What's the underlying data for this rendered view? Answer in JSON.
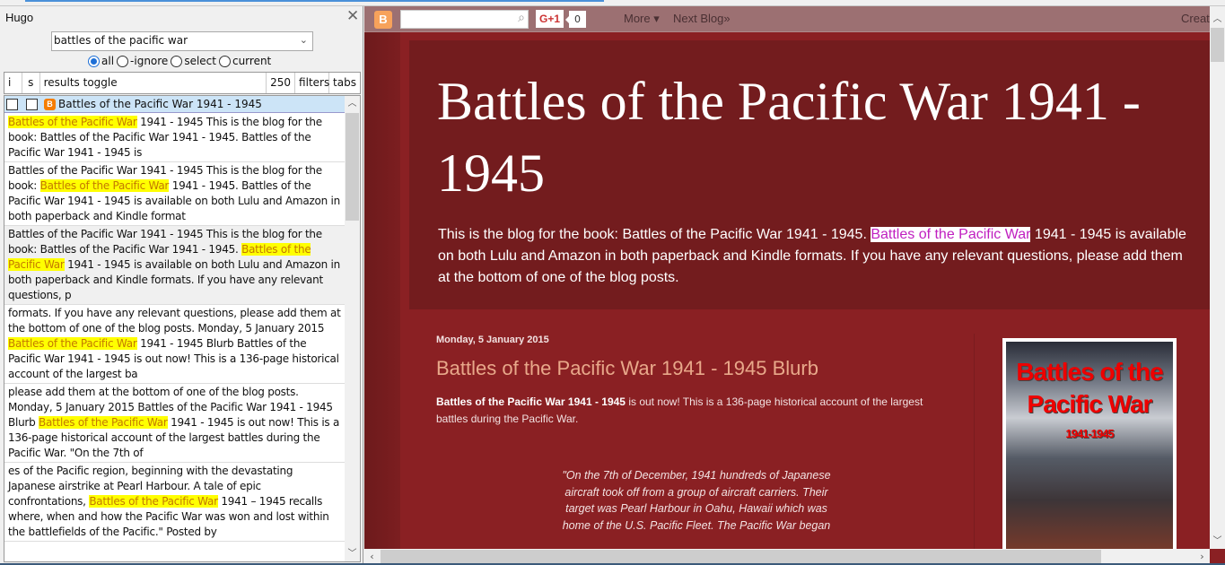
{
  "hugo": {
    "title": "Hugo",
    "close_glyph": "✕",
    "search_value": "battles of the pacific war",
    "radio_options": [
      {
        "label": "all",
        "selected": true
      },
      {
        "label": "-ignore",
        "selected": false
      },
      {
        "label": "select",
        "selected": false
      },
      {
        "label": "current",
        "selected": false
      }
    ],
    "columns": {
      "i": "i",
      "s": "s",
      "toggle": "results toggle",
      "count": "250",
      "filters": "filters",
      "tabs": "tabs"
    },
    "result_title": "Battles of the Pacific War 1941 - 1945",
    "highlight": "Battles of the Pacific War",
    "snippets": [
      {
        "before": "",
        "mark": "Battles of the Pacific War",
        "after": " 1941 - 1945 This is the blog for the book: Battles of the Pacific War 1941 - 1945. Battles of the Pacific War 1941 - 1945 is",
        "selected": false
      },
      {
        "before": "Battles of the Pacific War 1941 - 1945 This is the blog for the book: ",
        "mark": "Battles of the Pacific War",
        "after": " 1941 - 1945. Battles of the Pacific War 1941 - 1945 is available on both Lulu and Amazon in both paperback and Kindle format",
        "selected": false
      },
      {
        "before": "Battles of the Pacific War 1941 - 1945 This is the blog for the book: Battles of the Pacific War 1941 - 1945. ",
        "mark": "Battles of the Pacific War",
        "after": " 1941 - 1945 is available on both Lulu and Amazon in both paperback and Kindle formats. If you have any relevant questions, p",
        "selected": true
      },
      {
        "before": "formats. If you have any relevant questions, please add them at the bottom of one of the blog posts. Monday, 5 January 2015 ",
        "mark": "Battles of the Pacific War",
        "after": " 1941 - 1945 Blurb Battles of the Pacific War 1941 - 1945 is out now! This is a 136-page historical account of the largest ba",
        "selected": false
      },
      {
        "before": "please add them at the bottom of one of the blog posts. Monday, 5 January 2015 Battles of the Pacific War 1941 - 1945 Blurb ",
        "mark": "Battles of the Pacific War",
        "after": " 1941 - 1945 is out now! This is a 136-page historical account of the largest battles during the Pacific War. \"On the 7th of",
        "selected": false
      },
      {
        "before": "es of the Pacific region, beginning with the devastating Japanese airstrike at Pearl Harbour. A tale of epic confrontations, ",
        "mark": "Battles of the Pacific War",
        "after": " 1941 – 1945 recalls where, when and how the Pacific War was won and lost within the battlefields of the Pacific.\" Posted by",
        "selected": false
      }
    ]
  },
  "navbar": {
    "logo_glyph": "B",
    "search_icon_glyph": "⌕",
    "gplus_label": "G+1",
    "gplus_count": "0",
    "more_label": "More ▾",
    "next_blog_label": "Next Blog»",
    "create_label": "Create"
  },
  "blog": {
    "title": "Battles of the Pacific War 1941 - 1945",
    "desc_before": "This is the blog for the book: Battles of the Pacific War 1941 - 1945. ",
    "desc_mark": "Battles of the Pacific War",
    "desc_line1_after": " 1941 - 1945 is available",
    "desc_line2": "on both Lulu and Amazon in both paperback and Kindle formats. If you have any relevant questions, please add them",
    "desc_line3": "at the bottom of one of the blog posts.",
    "post_date": "Monday, 5 January 2015",
    "post_title": "Battles of the Pacific War 1941 - 1945 Blurb",
    "post_bold": "Battles of the Pacific War 1941 - 1945",
    "post_body": " is out now! This is a 136-page historical account of the largest battles during the Pacific War.",
    "quote": "\"On the 7th of December, 1941 hundreds of Japanese aircraft took off from a group of aircraft carriers. Their target was Pearl Harbour in Oahu, Hawaii which was home of the U.S. Pacific Fleet. The Pacific War began",
    "cover": {
      "line1": "Battles of the",
      "line2": "Pacific War",
      "line3": "1941-1945"
    }
  },
  "colors": {
    "highlight_bg": "#ffff00",
    "highlight_fg": "#c47900",
    "blog_bg": "#8a2023",
    "blog_header_bg": "#731c1e",
    "page_highlight_fg": "#c020c0"
  }
}
